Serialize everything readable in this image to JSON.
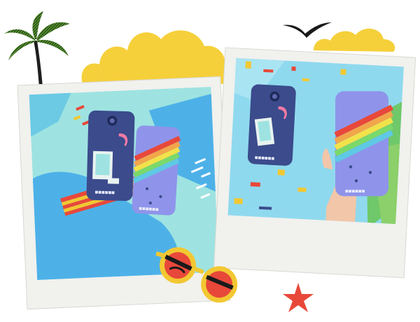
{
  "scene": {
    "colors": {
      "background": "#ffffff",
      "cloud": "#f5d03a",
      "polaroid_frame": "#f1f1ee",
      "backdrop_left": "#9ee3e1",
      "backdrop_right": "#8fd9ee",
      "paper_blue": "#4db1e8",
      "phone_navy": "#3b4b8c",
      "phone_periwinkle": "#8f94ea",
      "sunglass_frame": "#f2c832",
      "sunglass_lens": "#e8483a",
      "starfish": "#e8483a",
      "bird": "#1a1a1a",
      "palm_leaves": "#2a5a1e"
    },
    "icons": [
      "palm-tree-icon",
      "cloud-icon",
      "seagull-icon",
      "sunglasses-icon",
      "starfish-icon"
    ],
    "phone_case_brand": "■■■■■■"
  }
}
